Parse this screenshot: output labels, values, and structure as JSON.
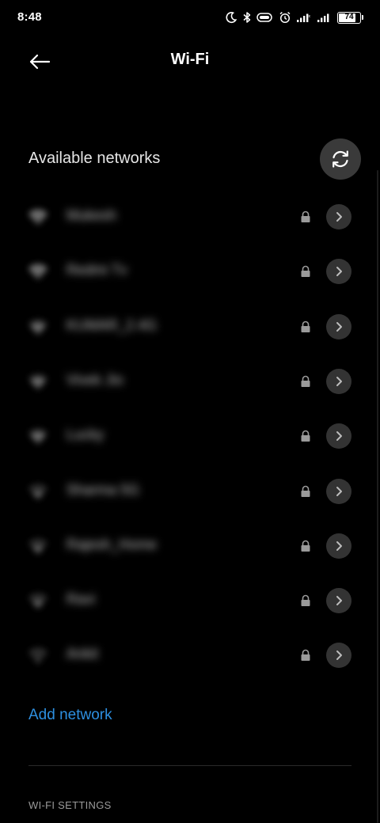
{
  "status_bar": {
    "time": "8:48",
    "battery_level": "74",
    "icons": [
      "moon-icon",
      "bluetooth-icon",
      "battery-saver-icon",
      "alarm-icon",
      "signal-icon",
      "signal-icon",
      "battery-icon"
    ]
  },
  "header": {
    "title": "Wi-Fi",
    "back_icon": "arrow-left-icon"
  },
  "available": {
    "title": "Available networks",
    "refresh_icon": "refresh-icon"
  },
  "networks": [
    {
      "name": "Mukesh",
      "signal": 4,
      "secured": true
    },
    {
      "name": "Redmi Tv",
      "signal": 4,
      "secured": true
    },
    {
      "name": "KUMAR_2.4G",
      "signal": 3,
      "secured": true
    },
    {
      "name": "Vivek Jio",
      "signal": 3,
      "secured": true
    },
    {
      "name": "Lucky",
      "signal": 3,
      "secured": true
    },
    {
      "name": "Sharma 5G",
      "signal": 2,
      "secured": true
    },
    {
      "name": "Rajesh_Home",
      "signal": 2,
      "secured": true
    },
    {
      "name": "Ravi",
      "signal": 2,
      "secured": true
    },
    {
      "name": "Ankit",
      "signal": 1,
      "secured": true
    }
  ],
  "add_network": "Add network",
  "settings_header": "WI-FI SETTINGS",
  "colors": {
    "background": "#000000",
    "accent": "#2d8fe0",
    "circle_button": "#333333"
  }
}
